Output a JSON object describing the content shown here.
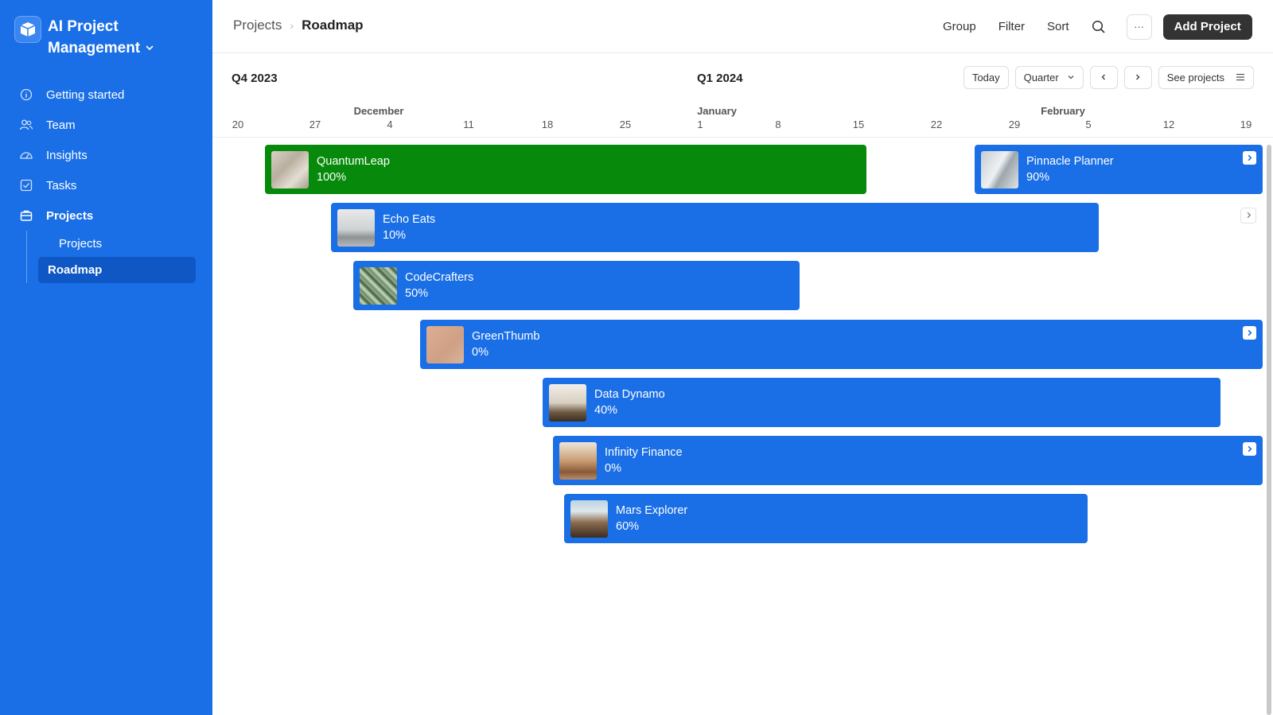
{
  "app": {
    "title_line1": "AI Project",
    "title_line2": "Management"
  },
  "sidebar": {
    "items": [
      {
        "label": "Getting started",
        "icon": "info-icon"
      },
      {
        "label": "Team",
        "icon": "team-icon"
      },
      {
        "label": "Insights",
        "icon": "gauge-icon"
      },
      {
        "label": "Tasks",
        "icon": "checkbox-icon"
      },
      {
        "label": "Projects",
        "icon": "briefcase-icon"
      }
    ],
    "subitems": [
      {
        "label": "Projects"
      },
      {
        "label": "Roadmap",
        "active": true
      }
    ]
  },
  "header": {
    "breadcrumb": [
      "Projects",
      "Roadmap"
    ],
    "group_label": "Group",
    "filter_label": "Filter",
    "sort_label": "Sort",
    "more_label": "···",
    "add_label": "Add Project"
  },
  "timeline": {
    "q4_label": "Q4 2023",
    "q1_label": "Q1 2024",
    "today_label": "Today",
    "zoom_value": "Quarter",
    "see_projects_label": "See projects",
    "months": [
      "December",
      "January",
      "February"
    ],
    "days": [
      "20",
      "27",
      "4",
      "11",
      "18",
      "25",
      "1",
      "8",
      "15",
      "22",
      "29",
      "5",
      "12",
      "19"
    ]
  },
  "projects": [
    {
      "name": "QuantumLeap",
      "progress": "100%"
    },
    {
      "name": "Pinnacle Planner",
      "progress": "90%"
    },
    {
      "name": "Echo Eats",
      "progress": "10%"
    },
    {
      "name": "CodeCrafters",
      "progress": "50%"
    },
    {
      "name": "GreenThumb",
      "progress": "0%"
    },
    {
      "name": "Data Dynamo",
      "progress": "40%"
    },
    {
      "name": "Infinity Finance",
      "progress": "0%"
    },
    {
      "name": "Mars Explorer",
      "progress": "60%"
    }
  ],
  "colors": {
    "sidebar": "#1a6fe6",
    "bar_blue": "#1a6fe6",
    "bar_complete": "#078a0b",
    "primary_button": "#333333"
  }
}
